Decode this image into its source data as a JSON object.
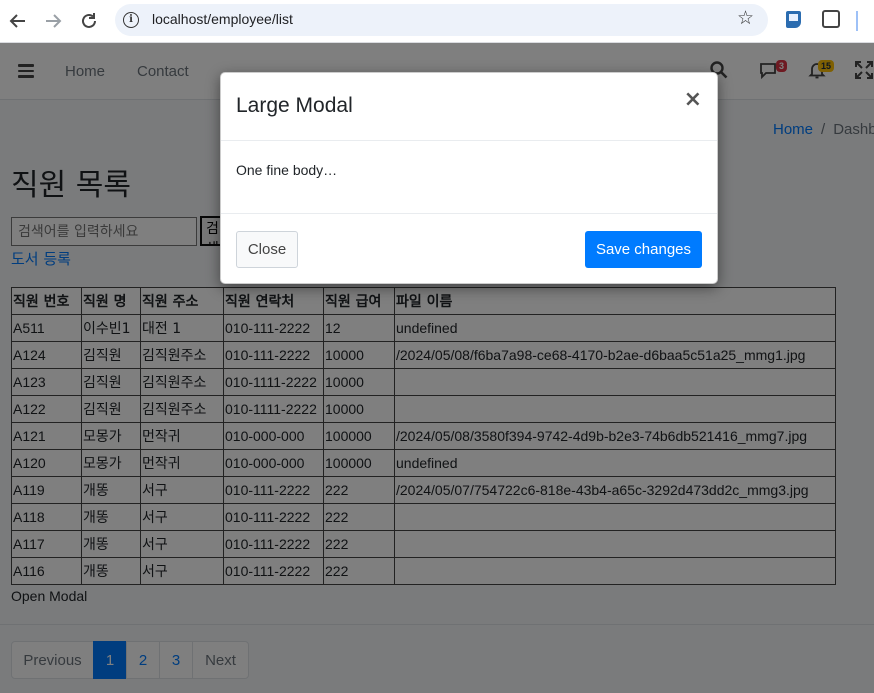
{
  "browser": {
    "url": "localhost/employee/list"
  },
  "topnav": {
    "home": "Home",
    "contact": "Contact",
    "chat_badge": "3",
    "notif_badge": "15"
  },
  "breadcrumb": {
    "home": "Home",
    "separator": "/",
    "current": "Dashb"
  },
  "page": {
    "title": "직원 목록",
    "search_placeholder": "검색어를 입력하세요",
    "search_button": "검색",
    "register_link": "도서 등록",
    "open_modal_text": "Open Modal"
  },
  "table": {
    "headers": [
      "직원 번호",
      "직원 명",
      "직원 주소",
      "직원 연락처",
      "직원 급여",
      "파일 이름"
    ],
    "rows": [
      [
        "A511",
        "이수빈1",
        "대전 1",
        "010-111-2222",
        "12",
        "undefined"
      ],
      [
        "A124",
        "김직원",
        "김직원주소",
        "010-111-2222",
        "10000",
        "/2024/05/08/f6ba7a98-ce68-4170-b2ae-d6baa5c51a25_mmg1.jpg"
      ],
      [
        "A123",
        "김직원",
        "김직원주소",
        "010-1111-2222",
        "10000",
        ""
      ],
      [
        "A122",
        "김직원",
        "김직원주소",
        "010-1111-2222",
        "10000",
        ""
      ],
      [
        "A121",
        "모몽가",
        "먼작귀",
        "010-000-000",
        "100000",
        "/2024/05/08/3580f394-9742-4d9b-b2e3-74b6db521416_mmg7.jpg"
      ],
      [
        "A120",
        "모몽가",
        "먼작귀",
        "010-000-000",
        "100000",
        "undefined"
      ],
      [
        "A119",
        "개똥",
        "서구",
        "010-111-2222",
        "222",
        "/2024/05/07/754722c6-818e-43b4-a65c-3292d473dd2c_mmg3.jpg"
      ],
      [
        "A118",
        "개똥",
        "서구",
        "010-111-2222",
        "222",
        ""
      ],
      [
        "A117",
        "개똥",
        "서구",
        "010-111-2222",
        "222",
        ""
      ],
      [
        "A116",
        "개똥",
        "서구",
        "010-111-2222",
        "222",
        ""
      ]
    ]
  },
  "pagination": {
    "previous": "Previous",
    "pages": [
      "1",
      "2",
      "3"
    ],
    "active_page": "1",
    "next": "Next"
  },
  "modal": {
    "title": "Large Modal",
    "close_symbol": "×",
    "body": "One fine body…",
    "close_button": "Close",
    "save_button": "Save changes"
  },
  "colors": {
    "primary": "#007bff",
    "badge_red": "#dc3545",
    "badge_yellow": "#ffc107",
    "backdrop": "rgba(0,0,0,0.5)"
  },
  "icons": {
    "back": "arrow-left-icon",
    "forward": "arrow-right-icon",
    "reload": "reload-icon",
    "site_info": "info-icon",
    "bookmark": "star-icon",
    "menu": "hamburger-icon",
    "search": "search-icon",
    "chat": "chat-icon",
    "notifications": "bell-icon",
    "fullscreen": "expand-icon",
    "modal_close": "close-icon"
  }
}
